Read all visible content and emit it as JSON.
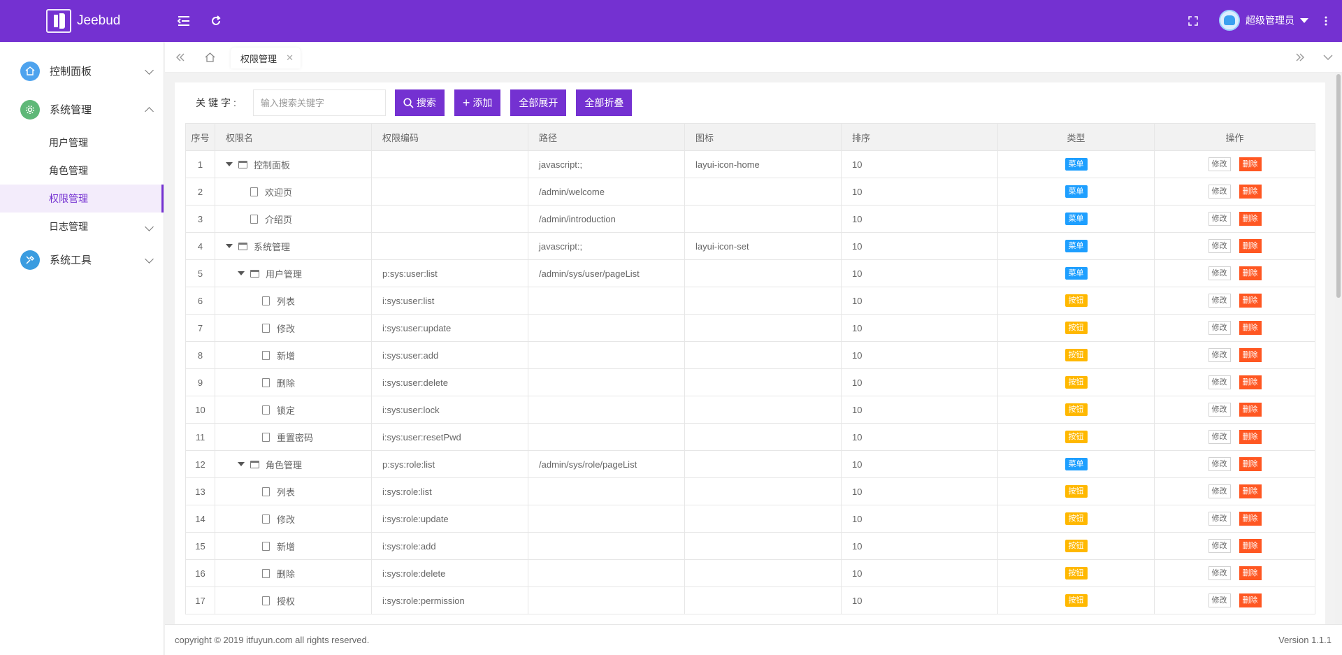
{
  "header": {
    "app_name": "Jeebud",
    "user_name": "超级管理员"
  },
  "sidebar": {
    "groups": [
      {
        "label": "控制面板",
        "icon": "home-icon",
        "color": "#4ea3ee"
      },
      {
        "label": "系统管理",
        "icon": "gear-icon",
        "color": "#5fb878"
      },
      {
        "label": "系统工具",
        "icon": "tools-icon",
        "color": "#3a9ce0"
      }
    ],
    "sub_items": [
      {
        "label": "用户管理"
      },
      {
        "label": "角色管理"
      },
      {
        "label": "权限管理"
      },
      {
        "label": "日志管理"
      }
    ]
  },
  "tabs": {
    "active_label": "权限管理"
  },
  "toolbar": {
    "keyword_label": "关键字:",
    "search_placeholder": "输入搜索关键字",
    "search_label": "搜索",
    "add_label": "添加",
    "expand_all_label": "全部展开",
    "collapse_all_label": "全部折叠"
  },
  "table": {
    "headers": [
      "序号",
      "权限名",
      "权限编码",
      "路径",
      "图标",
      "排序",
      "类型",
      "操作"
    ],
    "edit_label": "修改",
    "delete_label": "删除",
    "rows": [
      {
        "idx": "1",
        "name": "控制面板",
        "code": "",
        "path": "javascript:;",
        "icon": "layui-icon-home",
        "sort": "10",
        "type": "菜单"
      },
      {
        "idx": "2",
        "name": "欢迎页",
        "code": "",
        "path": "/admin/welcome",
        "icon": "",
        "sort": "10",
        "type": "菜单"
      },
      {
        "idx": "3",
        "name": "介绍页",
        "code": "",
        "path": "/admin/introduction",
        "icon": "",
        "sort": "10",
        "type": "菜单"
      },
      {
        "idx": "4",
        "name": "系统管理",
        "code": "",
        "path": "javascript:;",
        "icon": "layui-icon-set",
        "sort": "10",
        "type": "菜单"
      },
      {
        "idx": "5",
        "name": "用户管理",
        "code": "p:sys:user:list",
        "path": "/admin/sys/user/pageList",
        "icon": "",
        "sort": "10",
        "type": "菜单"
      },
      {
        "idx": "6",
        "name": "列表",
        "code": "i:sys:user:list",
        "path": "",
        "icon": "",
        "sort": "10",
        "type": "按钮"
      },
      {
        "idx": "7",
        "name": "修改",
        "code": "i:sys:user:update",
        "path": "",
        "icon": "",
        "sort": "10",
        "type": "按钮"
      },
      {
        "idx": "8",
        "name": "新增",
        "code": "i:sys:user:add",
        "path": "",
        "icon": "",
        "sort": "10",
        "type": "按钮"
      },
      {
        "idx": "9",
        "name": "删除",
        "code": "i:sys:user:delete",
        "path": "",
        "icon": "",
        "sort": "10",
        "type": "按钮"
      },
      {
        "idx": "10",
        "name": "锁定",
        "code": "i:sys:user:lock",
        "path": "",
        "icon": "",
        "sort": "10",
        "type": "按钮"
      },
      {
        "idx": "11",
        "name": "重置密码",
        "code": "i:sys:user:resetPwd",
        "path": "",
        "icon": "",
        "sort": "10",
        "type": "按钮"
      },
      {
        "idx": "12",
        "name": "角色管理",
        "code": "p:sys:role:list",
        "path": "/admin/sys/role/pageList",
        "icon": "",
        "sort": "10",
        "type": "菜单"
      },
      {
        "idx": "13",
        "name": "列表",
        "code": "i:sys:role:list",
        "path": "",
        "icon": "",
        "sort": "10",
        "type": "按钮"
      },
      {
        "idx": "14",
        "name": "修改",
        "code": "i:sys:role:update",
        "path": "",
        "icon": "",
        "sort": "10",
        "type": "按钮"
      },
      {
        "idx": "15",
        "name": "新增",
        "code": "i:sys:role:add",
        "path": "",
        "icon": "",
        "sort": "10",
        "type": "按钮"
      },
      {
        "idx": "16",
        "name": "删除",
        "code": "i:sys:role:delete",
        "path": "",
        "icon": "",
        "sort": "10",
        "type": "按钮"
      },
      {
        "idx": "17",
        "name": "授权",
        "code": "i:sys:role:permission",
        "path": "",
        "icon": "",
        "sort": "10",
        "type": "按钮"
      }
    ]
  },
  "footer": {
    "copyright": "copyright © 2019 itfuyun.com all rights reserved.",
    "version": "Version 1.1.1"
  }
}
